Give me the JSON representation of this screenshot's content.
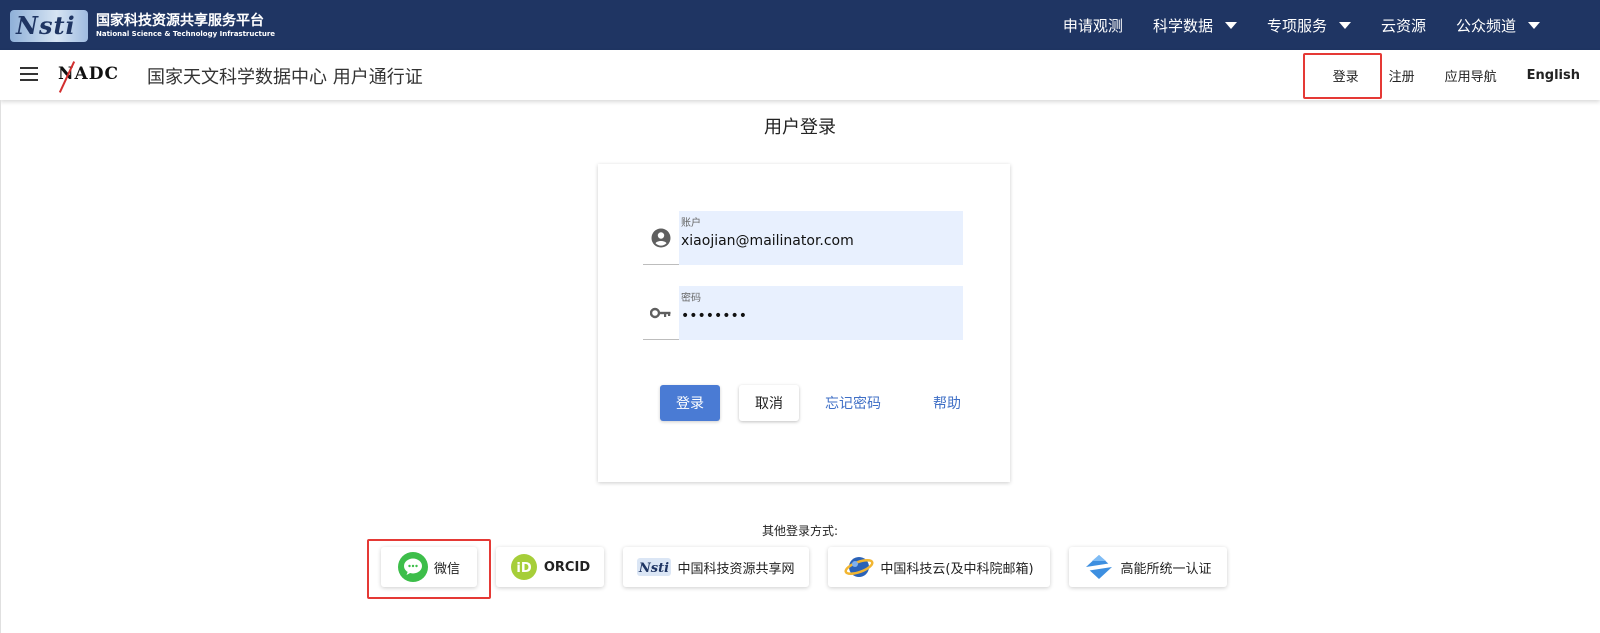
{
  "platform": {
    "logo_text": "Nsti",
    "name_cn": "国家科技资源共享服务平台",
    "name_en": "National Science & Technology Infrastructure",
    "nav": [
      {
        "label": "申请观测",
        "dropdown": false
      },
      {
        "label": "科学数据",
        "dropdown": true
      },
      {
        "label": "专项服务",
        "dropdown": true
      },
      {
        "label": "云资源",
        "dropdown": false
      },
      {
        "label": "公众频道",
        "dropdown": true
      }
    ]
  },
  "header": {
    "logo_text": "NADC",
    "site_title": "国家天文科学数据中心 用户通行证",
    "nav": {
      "login": "登录",
      "register": "注册",
      "app_nav": "应用导航",
      "english": "English"
    }
  },
  "login": {
    "title": "用户登录",
    "account_label": "账户",
    "account_value": "xiaojian@mailinator.com",
    "password_label": "密码",
    "password_value": "••••••••",
    "submit": "登录",
    "cancel": "取消",
    "forgot": "忘记密码",
    "help": "帮助"
  },
  "other_logins": {
    "title": "其他登录方式:",
    "options": [
      {
        "label": "微信",
        "icon": "wechat-icon"
      },
      {
        "label": "ORCID",
        "icon": "orcid-icon"
      },
      {
        "label": "中国科技资源共享网",
        "icon": "nsti-icon"
      },
      {
        "label": "中国科技云(及中科院邮箱)",
        "icon": "cstcloud-icon"
      },
      {
        "label": "高能所统一认证",
        "icon": "ihep-icon"
      }
    ]
  },
  "colors": {
    "topbar": "#1f3563",
    "primary": "#4a7bd4",
    "link": "#3f6fc6",
    "highlight": "#e53935",
    "field_bg": "#e8f0fe"
  }
}
